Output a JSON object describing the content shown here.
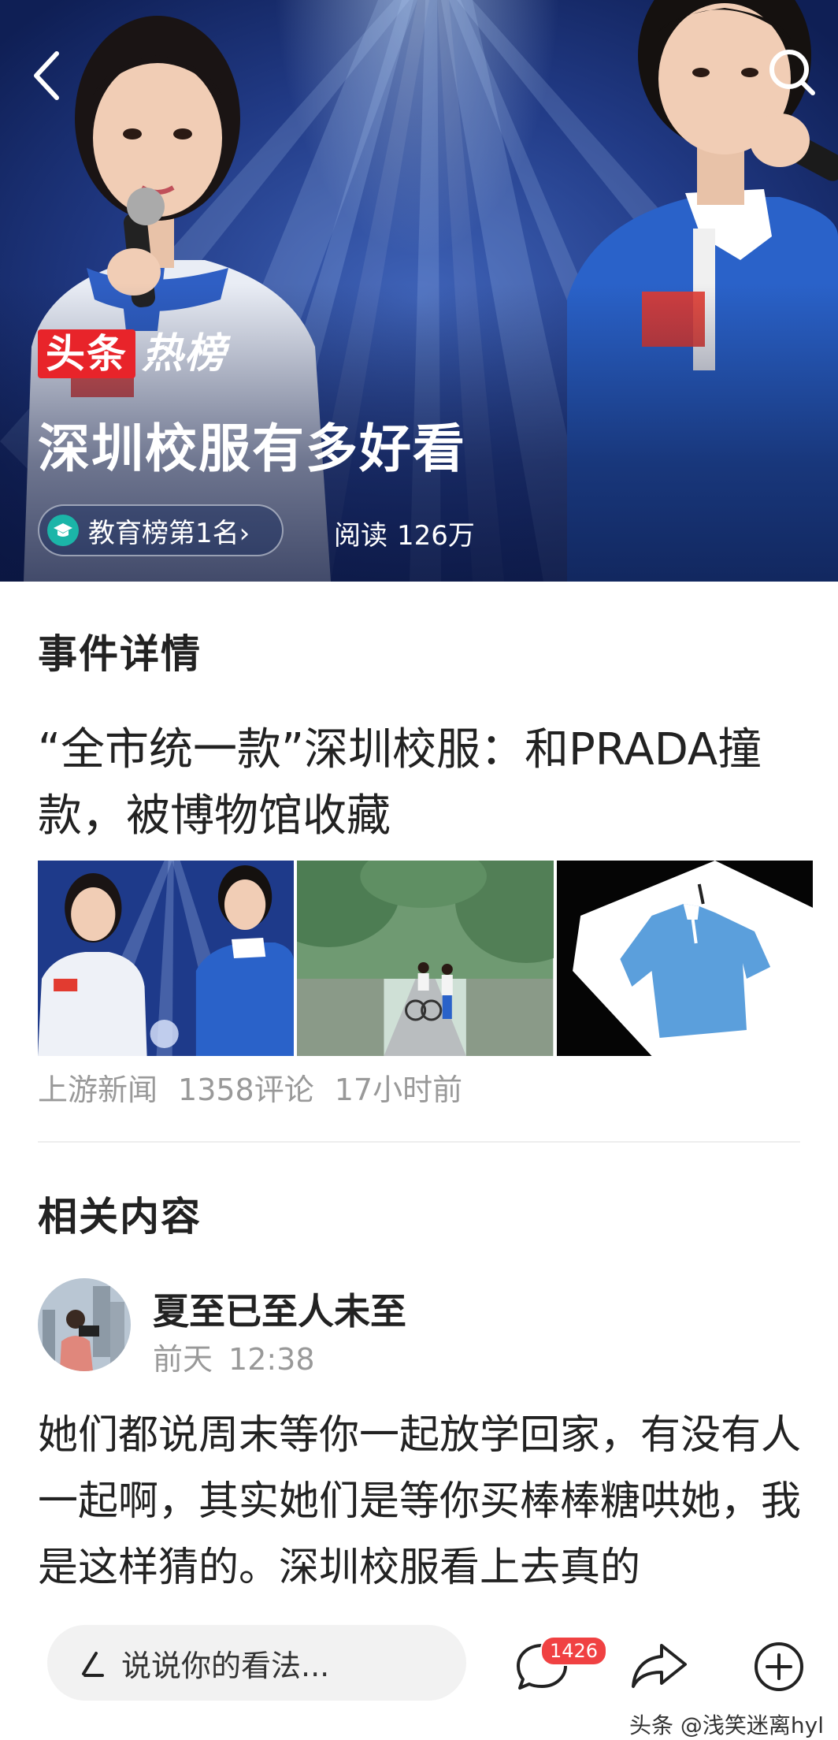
{
  "hero": {
    "brand_part1": "头条",
    "brand_part2": "热榜",
    "title": "深圳校服有多好看",
    "rank_label": "教育榜第1名",
    "rank_chevron": "›",
    "read_label": "阅读",
    "read_count": "126万",
    "icons": {
      "back": "back-chevron-icon",
      "search": "search-icon",
      "rank": "graduation-cap-icon"
    }
  },
  "event": {
    "section_title": "事件详情",
    "headline": "“全市统一款”深圳校服：和PRADA撞款，被博物馆收藏",
    "source": "上游新闻",
    "comments": "1358评论",
    "time": "17小时前",
    "thumbnails": [
      "stage-singers-photo",
      "students-cycling-photo",
      "blue-polo-shirt-photo"
    ]
  },
  "related": {
    "section_title": "相关内容",
    "author": "夏至已至人未至",
    "date": "前天",
    "time": "12:38",
    "body": "她们都说周末等你一起放学回家，有没有人一起啊，其实她们是等你买棒棒糖哄她，我是这样猜的。深圳校服看上去真的"
  },
  "bottom_bar": {
    "input_placeholder": "说说你的看法...",
    "comment_count": "1426",
    "icons": {
      "pen": "pen-icon",
      "comment": "comment-icon",
      "share": "share-icon",
      "more": "plus-circle-icon"
    }
  },
  "watermark": "头条 @浅笑迷离hyl",
  "colors": {
    "brand_red": "#e8242a",
    "badge_red": "#f04142",
    "rank_icon": "#1bb5a8"
  }
}
